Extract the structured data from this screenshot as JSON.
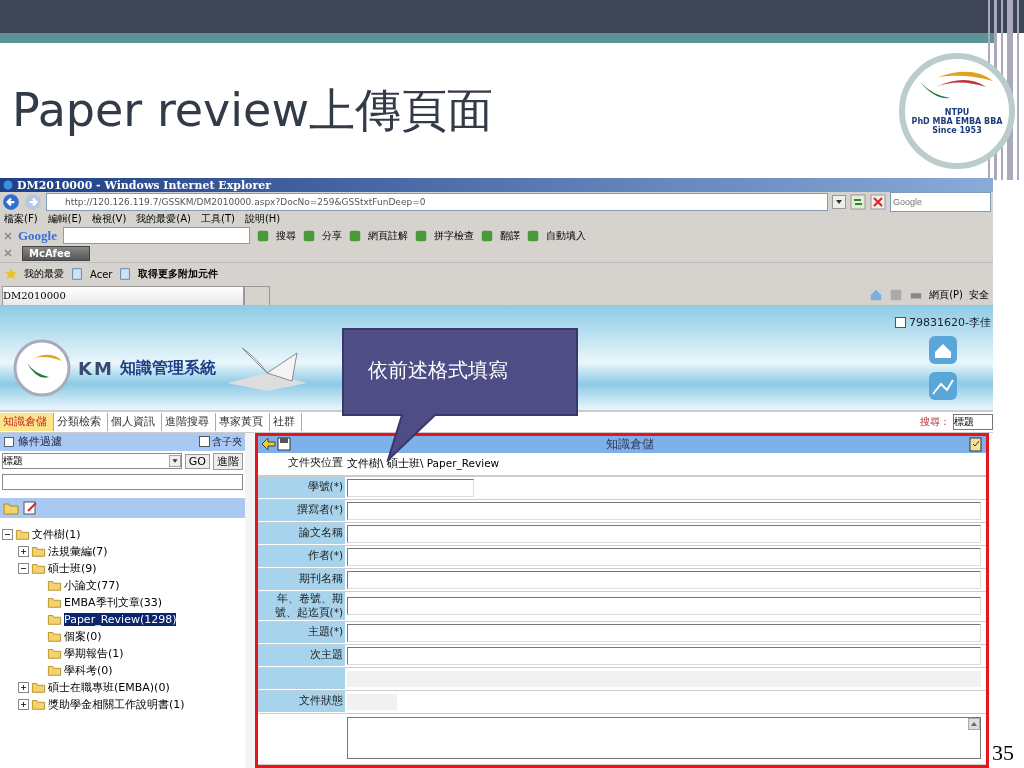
{
  "slide": {
    "title": "Paper review上傳頁面",
    "page_number": "35",
    "logo": {
      "texts": [
        "NTPU",
        "PhD MBA EMBA BBA",
        "Since 1953"
      ]
    }
  },
  "callout": {
    "text": "依前述格式填寫"
  },
  "browser": {
    "title": "DM2010000 - Windows Internet Explorer",
    "address": "http://120.126.119.7/GSSKM/DM2010000.aspx?DocNo=259&GSStxtFunDeep=0",
    "search_placeholder": "Google",
    "menu": [
      "檔案(F)",
      "編輯(E)",
      "檢視(V)",
      "我的最愛(A)",
      "工具(T)",
      "說明(H)"
    ],
    "google_toolbar": {
      "brand": "Google",
      "items": [
        "搜尋",
        "分享",
        "網頁註解",
        "拼字檢查",
        "翻譯",
        "自動填入"
      ]
    },
    "mcafee": "McAfee",
    "favorites": {
      "label": "我的最愛",
      "items": [
        "Acer",
        "取得更多附加元件"
      ]
    },
    "tab": "DM2010000",
    "commands": [
      "網頁(P)",
      "安全"
    ]
  },
  "page": {
    "header": {
      "km": "KM",
      "system_name": "知識管理系統",
      "user": "79831620-李佳"
    },
    "nav": [
      {
        "label": "知識倉儲",
        "selected": true
      },
      {
        "label": "分類檢索",
        "selected": false
      },
      {
        "label": "個人資訊",
        "selected": false
      },
      {
        "label": "進階搜尋",
        "selected": false
      },
      {
        "label": "專家黃頁",
        "selected": false
      },
      {
        "label": "社群",
        "selected": false
      }
    ],
    "search_label": "搜尋：",
    "search_value": "標題",
    "filter": {
      "title": "條件過濾",
      "include_sub": {
        "label": "含子夾",
        "checked": false
      },
      "select": "標題",
      "buttons": [
        "GO",
        "進階"
      ]
    },
    "tree": [
      {
        "label": "文件樹(1)",
        "expanded": true,
        "selected": false,
        "children": [
          {
            "label": "法規彙編(7)",
            "expanded": false,
            "selected": false
          },
          {
            "label": "碩士班(9)",
            "expanded": true,
            "selected": false,
            "children": [
              {
                "label": "小論文(77)",
                "selected": false
              },
              {
                "label": "EMBA季刊文章(33)",
                "selected": false
              },
              {
                "label": "Paper_Review(1298)",
                "selected": true
              },
              {
                "label": "個案(0)",
                "selected": false
              },
              {
                "label": "學期報告(1)",
                "selected": false
              },
              {
                "label": "學科考(0)",
                "selected": false
              }
            ]
          },
          {
            "label": "碩士在職專班(EMBA)(0)",
            "expanded": false,
            "selected": false
          },
          {
            "label": "獎助學金相關工作說明書(1)",
            "expanded": false,
            "selected": false
          }
        ]
      }
    ],
    "form": {
      "title": "知識倉儲",
      "location_label": "文件夾位置",
      "location": "文件樹\\ 碩士班\\ Paper_Review",
      "fields": [
        {
          "label": "學號(*)",
          "kind": "short"
        },
        {
          "label": "撰寫者(*)",
          "kind": "long"
        },
        {
          "label": "論文名稱",
          "kind": "long"
        },
        {
          "label": "作者(*)",
          "kind": "long"
        },
        {
          "label": "期刊名稱",
          "kind": "long"
        },
        {
          "label": "年、卷號、期號、起迄頁(*)",
          "kind": "long"
        },
        {
          "label": "主題(*)",
          "kind": "long"
        },
        {
          "label": "次主題",
          "kind": "long"
        },
        {
          "kind": "blank"
        },
        {
          "label": "文件狀態",
          "kind": "status"
        },
        {
          "kind": "textarea"
        }
      ]
    }
  }
}
